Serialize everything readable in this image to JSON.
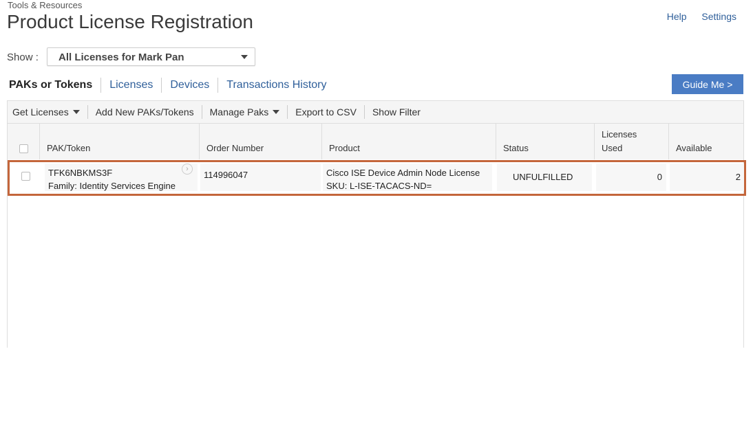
{
  "breadcrumb": "Tools & Resources",
  "title": "Product License Registration",
  "top_links": {
    "help": "Help",
    "settings": "Settings"
  },
  "show": {
    "label": "Show :",
    "selected": "All Licenses for Mark Pan"
  },
  "tabs": [
    {
      "label": "PAKs or Tokens",
      "active": true
    },
    {
      "label": "Licenses"
    },
    {
      "label": "Devices"
    },
    {
      "label": "Transactions History"
    }
  ],
  "guide_button": "Guide Me >",
  "toolbar": {
    "get_licenses": "Get Licenses",
    "add_new": "Add New PAKs/Tokens",
    "manage_paks": "Manage Paks",
    "export_csv": "Export to CSV",
    "show_filter": "Show Filter"
  },
  "table": {
    "columns": [
      "PAK/Token",
      "Order Number",
      "Product",
      "Status",
      "Licenses Used",
      "Available"
    ],
    "rows": [
      {
        "pak": "TFK6NBKMS3F",
        "family": "Family: Identity Services Engine",
        "order_number": "114996047",
        "product": "Cisco ISE Device Admin Node License",
        "sku": "SKU: L-ISE-TACACS-ND=",
        "status": "UNFULFILLED",
        "licenses_used": "0",
        "available": "2"
      }
    ]
  },
  "colors": {
    "link": "#2f5f9a",
    "guide_button": "#4a7cc4",
    "highlight": "#c4663b"
  }
}
